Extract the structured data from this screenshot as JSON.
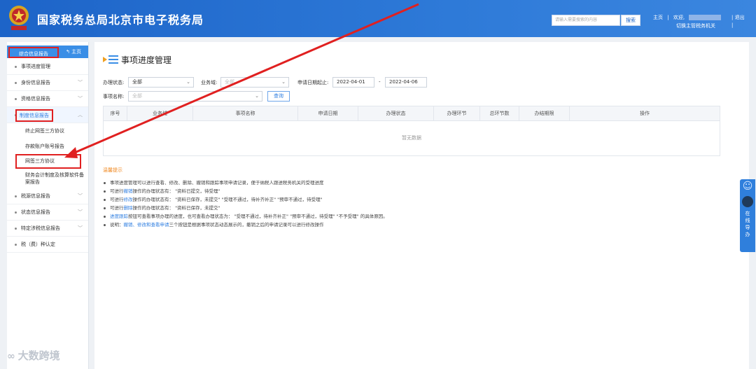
{
  "header": {
    "title": "国家税务总局北京市电子税务局",
    "search_placeholder": "请输入需要搜索的内容",
    "search_button": "搜索",
    "home": "主页",
    "welcome": "欢迎,",
    "logout": "退出",
    "switch_org": "切换主管税务机关",
    "brand_color": "#1d64c8"
  },
  "sidebar": {
    "head_label": "综合信息报告",
    "home_link": "主页",
    "items": [
      {
        "label": "事项进度管理",
        "chevron": ""
      },
      {
        "label": "身份信息报告",
        "chevron": "﹀"
      },
      {
        "label": "资格信息报告",
        "chevron": "﹀"
      },
      {
        "label": "制度信息报告",
        "chevron": "︿"
      },
      {
        "label": "税源信息报告",
        "chevron": "﹀"
      },
      {
        "label": "状态信息报告",
        "chevron": "﹀"
      },
      {
        "label": "特定涉税信息报告",
        "chevron": "﹀"
      },
      {
        "label": "税（费）种认定",
        "chevron": ""
      }
    ],
    "sub_items": [
      {
        "label": "终止网签三方协议"
      },
      {
        "label": "存款账户账号报告"
      },
      {
        "label": "网签三方协议"
      },
      {
        "label": "财务会计制度及核算软件备案报告"
      }
    ]
  },
  "main": {
    "title": "事项进度管理",
    "filters": {
      "status_label": "办理状态:",
      "status_value": "全部",
      "biz_domain_label": "业务域:",
      "biz_domain_value": "全部",
      "date_label": "申请日期起止:",
      "date_from": "2022-04-01",
      "date_sep": "-",
      "date_to": "2022-04-06",
      "item_name_label": "事项名称:",
      "item_name_value": "全部",
      "query_button": "查询"
    },
    "table": {
      "columns": [
        "序号",
        "业务域",
        "事项名称",
        "申请日期",
        "办理状态",
        "办理环节",
        "总环节数",
        "办结期限",
        "操作"
      ],
      "empty_text": "暂无数据"
    },
    "tips_title": "温馨提示",
    "tips": [
      {
        "pre": "事项进度管理可以进行查看、修改、删除、撤销和跟踪事项申请记录，便于纳税人跟进税务机关的受理进度",
        "hl": "",
        "post": ""
      },
      {
        "pre": "可进行",
        "hl": "撤销",
        "post": "操作的办理状态有：  \"资料已提交，待受理\""
      },
      {
        "pre": "可进行",
        "hl": "修改",
        "post": "操作的办理状态有：  \"资料已保存，未提交\"   \"受理不通过，待补齐补正\"   \"预审不通过，待受理\""
      },
      {
        "pre": "可进行",
        "hl": "删除",
        "post": "操作的办理状态有：  \"资料已保存，未提交\""
      },
      {
        "pre": "",
        "hl": "进度跟踪",
        "post": "按钮可查看事项办理的进度，也可查看办理状态为：  \"受理不通过，待补齐补正\"   \"预审不通过，待受理\"   \"不予受理\"  的具体原因。"
      },
      {
        "pre": "说明：",
        "hl": "撤销、修改和查看申请",
        "post": "三个按钮是根据事项状态动态展示的，撤销之后的申请记录可以进行修改操作"
      }
    ]
  },
  "float_panel": {
    "text": "在线导办"
  },
  "watermark": "大数跨境"
}
